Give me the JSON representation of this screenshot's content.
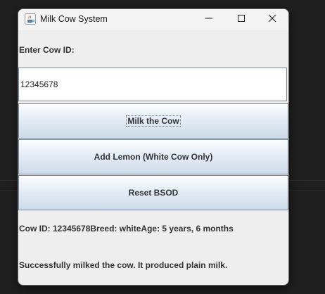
{
  "window": {
    "title": "Milk Cow System",
    "icon": "java-cup-icon",
    "controls": [
      "minimize-icon",
      "maximize-icon",
      "close-icon"
    ]
  },
  "form": {
    "prompt_label": "Enter Cow ID:",
    "cow_id_value": "12345678"
  },
  "buttons": {
    "milk_label": "Milk the Cow",
    "lemon_label": "Add Lemon (White Cow Only)",
    "reset_label": "Reset BSOD"
  },
  "output": {
    "cow_info": "Cow ID: 12345678Breed: whiteAge: 5 years, 6 months",
    "status_message": "Successfully milked the cow. It produced plain milk."
  }
}
